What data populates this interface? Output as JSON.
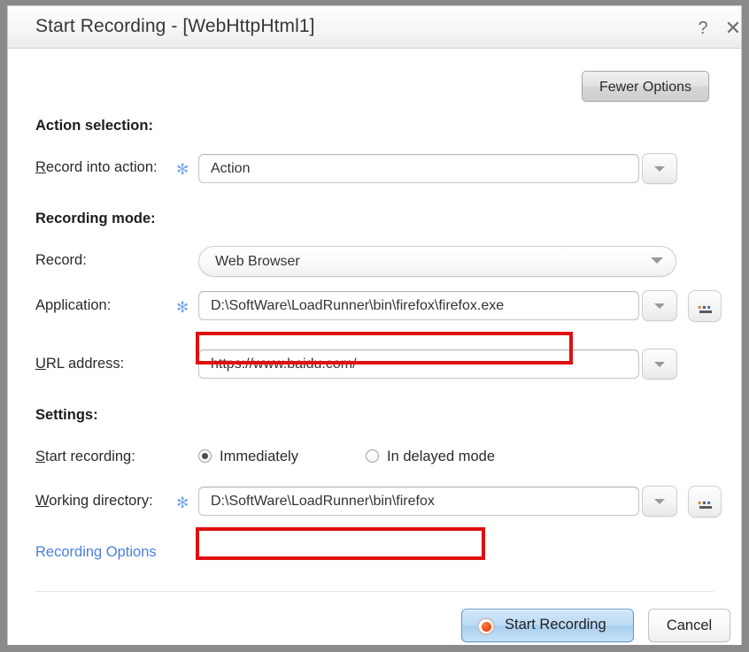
{
  "window": {
    "title": "Start Recording - [WebHttpHtml1]",
    "help_icon": "question-mark-icon",
    "close_icon": "close-icon"
  },
  "toolbar": {
    "fewer_options_label": "Fewer Options"
  },
  "sections": {
    "action_selection": {
      "heading": "Action selection:",
      "record_into_action": {
        "label_accelerator": "R",
        "label_rest": "ecord into action:",
        "required_marker": "✻",
        "value": "Action",
        "dropdown_icon": "chevron-down-icon"
      }
    },
    "recording_mode": {
      "heading": "Recording mode:",
      "record": {
        "label": "Record:",
        "value": "Web Browser",
        "dropdown_icon": "chevron-down-icon"
      },
      "application": {
        "label": "Application:",
        "required_marker": "✻",
        "value": "D:\\SoftWare\\LoadRunner\\bin\\firefox\\firefox.exe",
        "dropdown_icon": "chevron-down-icon",
        "browse_label": "...",
        "browse_icon": "ellipsis-browse-icon"
      },
      "url_address": {
        "label_accelerator": "U",
        "label_rest": "RL address:",
        "value": "https://www.baidu.com/",
        "dropdown_icon": "chevron-down-icon"
      }
    },
    "settings": {
      "heading": "Settings:",
      "start_recording": {
        "label_accelerator": "S",
        "label_rest": "tart recording:",
        "options": [
          {
            "label": "Immediately",
            "selected": true
          },
          {
            "label": "In delayed mode",
            "selected": false
          }
        ]
      },
      "working_directory": {
        "label_accelerator": "W",
        "label_rest": "orking directory:",
        "required_marker": "✻",
        "value": "D:\\SoftWare\\LoadRunner\\bin\\firefox",
        "dropdown_icon": "chevron-down-icon",
        "browse_label": "...",
        "browse_icon": "ellipsis-browse-icon"
      }
    }
  },
  "links": {
    "recording_options": "Recording Options"
  },
  "footer": {
    "start_recording_label": "Start Recording",
    "start_recording_icon": "record-dot-icon",
    "cancel_label": "Cancel"
  },
  "colors": {
    "link": "#4a7fe0",
    "required_star": "#7aa7e8",
    "annotation": "#e00f0f",
    "primary_button": "#bbdaf4",
    "record_dot": "#ef4210"
  }
}
